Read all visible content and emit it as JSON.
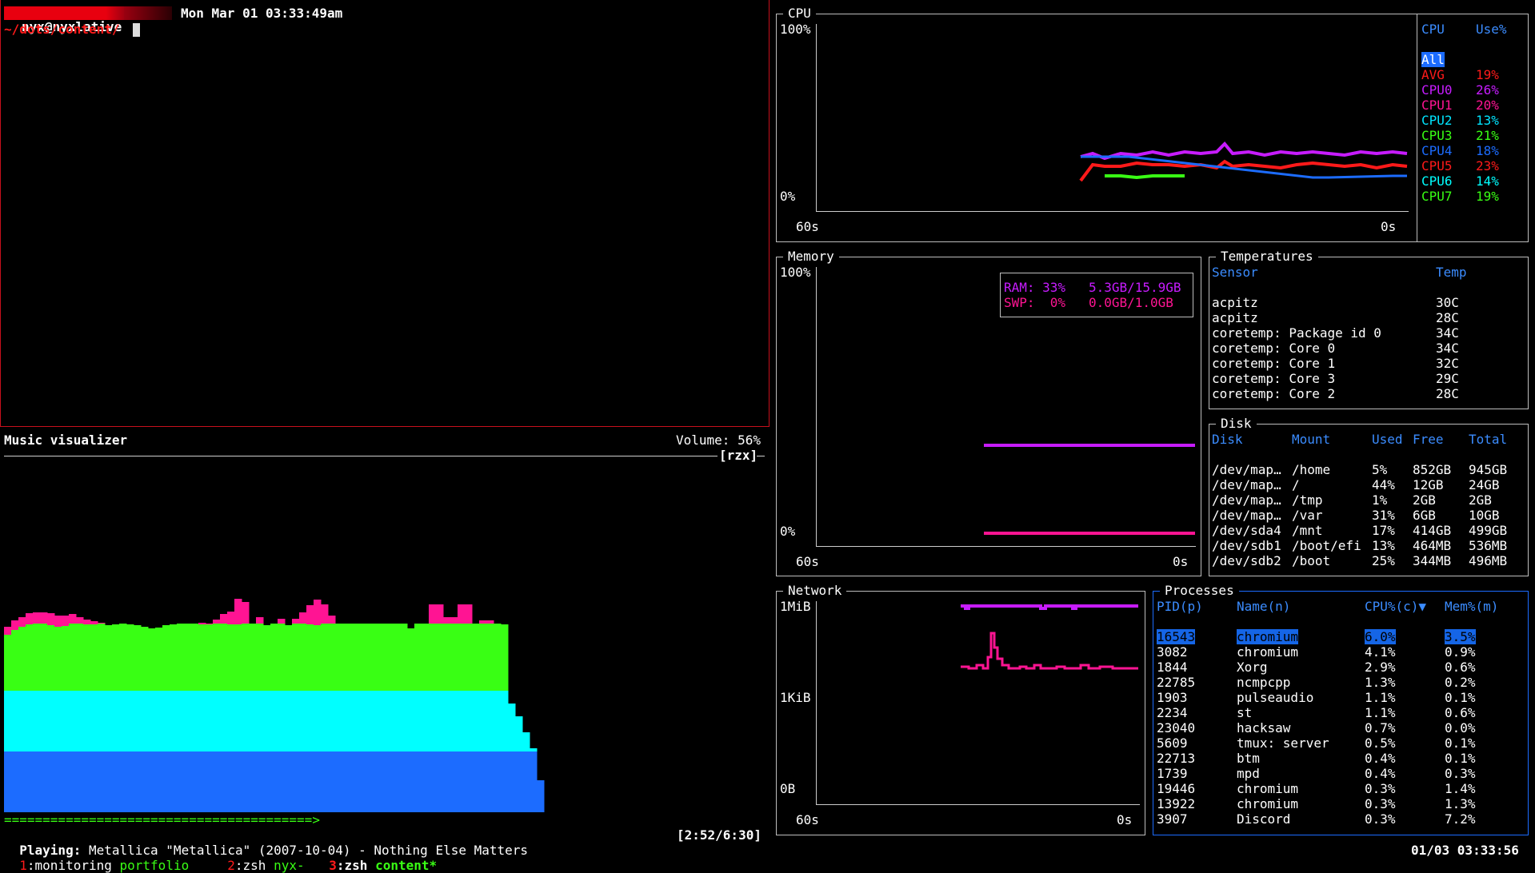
{
  "terminal": {
    "user_host": "nyx@nyxlative",
    "datetime": "Mon Mar 01 03:33:49am",
    "cwd": "~/dots/content/",
    "colors": {
      "prompt_bg": "#e8000f",
      "cwd": "#ff1a1a",
      "border": "#c8101c"
    }
  },
  "visualizer": {
    "title": "Music visualizer",
    "volume": "Volume: 56%",
    "flags": "[rzx]",
    "progress_bar": "========================================>",
    "playing_label": "Playing:",
    "track": "Metallica \"Metallica\" (2007-10-04) - Nothing Else Matters",
    "time": "[2:52/6:30]",
    "colors": {
      "pink": "#ff1493",
      "green": "#39ff14",
      "cyan": "#00ffff",
      "blue": "#1c6cff"
    },
    "bars": [
      [
        70,
        10,
        0
      ],
      [
        76,
        12,
        0
      ],
      [
        80,
        12,
        0
      ],
      [
        83,
        14,
        0
      ],
      [
        84,
        14,
        0
      ],
      [
        84,
        14,
        0
      ],
      [
        82,
        15,
        0
      ],
      [
        80,
        14,
        0
      ],
      [
        81,
        13,
        0
      ],
      [
        84,
        12,
        0
      ],
      [
        84,
        8,
        0
      ],
      [
        83,
        6,
        0
      ],
      [
        83,
        4,
        0
      ],
      [
        84,
        1,
        0
      ],
      [
        82,
        0,
        0
      ],
      [
        83,
        0,
        0
      ],
      [
        84,
        0,
        0
      ],
      [
        83,
        0,
        0
      ],
      [
        82,
        0,
        0
      ],
      [
        80,
        0,
        0
      ],
      [
        78,
        0,
        0
      ],
      [
        79,
        0,
        0
      ],
      [
        82,
        0,
        0
      ],
      [
        83,
        0,
        0
      ],
      [
        84,
        0,
        0
      ],
      [
        84,
        0,
        0
      ],
      [
        84,
        0,
        0
      ],
      [
        83,
        2,
        0
      ],
      [
        83,
        1,
        0
      ],
      [
        84,
        5,
        0
      ],
      [
        84,
        12,
        0
      ],
      [
        83,
        16,
        0
      ],
      [
        83,
        32,
        0
      ],
      [
        84,
        27,
        0
      ],
      [
        84,
        0,
        0
      ],
      [
        84,
        8,
        0
      ],
      [
        82,
        0,
        0
      ],
      [
        84,
        0,
        0
      ],
      [
        84,
        6,
        0
      ],
      [
        82,
        0,
        0
      ],
      [
        84,
        6,
        0
      ],
      [
        84,
        14,
        0
      ],
      [
        83,
        24,
        0
      ],
      [
        82,
        32,
        0
      ],
      [
        84,
        24,
        0
      ],
      [
        84,
        10,
        0
      ],
      [
        84,
        0,
        0
      ],
      [
        84,
        0,
        0
      ],
      [
        84,
        0,
        0
      ],
      [
        84,
        0,
        0
      ],
      [
        84,
        0,
        0
      ],
      [
        84,
        0,
        0
      ],
      [
        84,
        0,
        0
      ],
      [
        84,
        0,
        0
      ],
      [
        84,
        0,
        0
      ],
      [
        84,
        0,
        0
      ],
      [
        78,
        0,
        0
      ],
      [
        84,
        0,
        0
      ],
      [
        84,
        0,
        0
      ],
      [
        84,
        24,
        0
      ],
      [
        84,
        24,
        0
      ],
      [
        84,
        8,
        0
      ],
      [
        84,
        8,
        0
      ],
      [
        84,
        24,
        0
      ],
      [
        84,
        24,
        0
      ],
      [
        84,
        0,
        0
      ],
      [
        84,
        4,
        0
      ],
      [
        84,
        4,
        0
      ],
      [
        84,
        0,
        0
      ],
      [
        83,
        0,
        0
      ]
    ]
  },
  "statusbar": {
    "windows": [
      {
        "num": "1",
        "name": ":monitoring",
        "extra": "portfolio"
      },
      {
        "num": "2",
        "name": ":zsh",
        "extra": "nyx-"
      },
      {
        "num": "3",
        "name": ":zsh",
        "extra": "content*"
      }
    ],
    "clock": "01/03 03:33:56"
  },
  "cpu": {
    "title": "CPU",
    "y_max": "100%",
    "y_min": "0%",
    "x_left": "60s",
    "x_right": "0s",
    "legend_header": {
      "cpu": "CPU",
      "use": "Use%"
    },
    "legend": [
      {
        "name": "All",
        "use": "",
        "color": "#1c6cff",
        "selected": true
      },
      {
        "name": "AVG",
        "use": "19%",
        "color": "#ff1a1a"
      },
      {
        "name": "CPU0",
        "use": "26%",
        "color": "#c71cff"
      },
      {
        "name": "CPU1",
        "use": "20%",
        "color": "#ff1493"
      },
      {
        "name": "CPU2",
        "use": "13%",
        "color": "#00e5ff"
      },
      {
        "name": "CPU3",
        "use": "21%",
        "color": "#39ff14"
      },
      {
        "name": "CPU4",
        "use": "18%",
        "color": "#1c6cff"
      },
      {
        "name": "CPU5",
        "use": "23%",
        "color": "#ff1a1a"
      },
      {
        "name": "CPU6",
        "use": "14%",
        "color": "#00ffff"
      },
      {
        "name": "CPU7",
        "use": "19%",
        "color": "#39ff14"
      }
    ]
  },
  "memory": {
    "title": "Memory",
    "y_max": "100%",
    "y_min": "0%",
    "x_left": "60s",
    "x_right": "0s",
    "ram": "RAM: 33%   5.3GB/15.9GB",
    "swp": "SWP:  0%   0.0GB/1.0GB",
    "ram_pct": 33,
    "swp_pct": 0
  },
  "temperatures": {
    "title": "Temperatures",
    "header": {
      "sensor": "Sensor",
      "temp": "Temp"
    },
    "rows": [
      {
        "sensor": "acpitz",
        "temp": "30C"
      },
      {
        "sensor": "acpitz",
        "temp": "28C"
      },
      {
        "sensor": "coretemp: Package id 0",
        "temp": "34C"
      },
      {
        "sensor": "coretemp: Core 0",
        "temp": "34C"
      },
      {
        "sensor": "coretemp: Core 1",
        "temp": "32C"
      },
      {
        "sensor": "coretemp: Core 3",
        "temp": "29C"
      },
      {
        "sensor": "coretemp: Core 2",
        "temp": "28C"
      }
    ]
  },
  "disk": {
    "title": "Disk",
    "header": [
      "Disk",
      "Mount",
      "Used",
      "Free",
      "Total"
    ],
    "rows": [
      [
        "/dev/map…",
        "/home",
        "5%",
        "852GB",
        "945GB"
      ],
      [
        "/dev/map…",
        "/",
        "44%",
        "12GB",
        "24GB"
      ],
      [
        "/dev/map…",
        "/tmp",
        "1%",
        "2GB",
        "2GB"
      ],
      [
        "/dev/map…",
        "/var",
        "31%",
        "6GB",
        "10GB"
      ],
      [
        "/dev/sda4",
        "/mnt",
        "17%",
        "414GB",
        "499GB"
      ],
      [
        "/dev/sdb1",
        "/boot/efi",
        "13%",
        "464MB",
        "536MB"
      ],
      [
        "/dev/sdb2",
        "/boot",
        "25%",
        "344MB",
        "496MB"
      ]
    ]
  },
  "network": {
    "title": "Network",
    "y_top": "1MiB",
    "y_mid": "1KiB",
    "y_bottom": "0B",
    "x_left": "60s",
    "x_right": "0s"
  },
  "processes": {
    "title": "Processes",
    "header": [
      "PID(p)",
      "Name(n)",
      "CPU%(c)▼",
      "Mem%(m)"
    ],
    "rows": [
      [
        "16543",
        "chromium",
        "6.0%",
        "3.5%"
      ],
      [
        "3082",
        "chromium",
        "4.1%",
        "0.9%"
      ],
      [
        "1844",
        "Xorg",
        "2.9%",
        "0.6%"
      ],
      [
        "22785",
        "ncmpcpp",
        "1.3%",
        "0.2%"
      ],
      [
        "1903",
        "pulseaudio",
        "1.1%",
        "0.1%"
      ],
      [
        "2234",
        "st",
        "1.1%",
        "0.6%"
      ],
      [
        "23040",
        "hacksaw",
        "0.7%",
        "0.0%"
      ],
      [
        "5609",
        "tmux: server",
        "0.5%",
        "0.1%"
      ],
      [
        "22713",
        "btm",
        "0.4%",
        "0.1%"
      ],
      [
        "1739",
        "mpd",
        "0.4%",
        "0.3%"
      ],
      [
        "19446",
        "chromium",
        "0.3%",
        "1.4%"
      ],
      [
        "13922",
        "chromium",
        "0.3%",
        "1.3%"
      ],
      [
        "3907",
        "Discord",
        "0.3%",
        "7.2%"
      ]
    ]
  }
}
